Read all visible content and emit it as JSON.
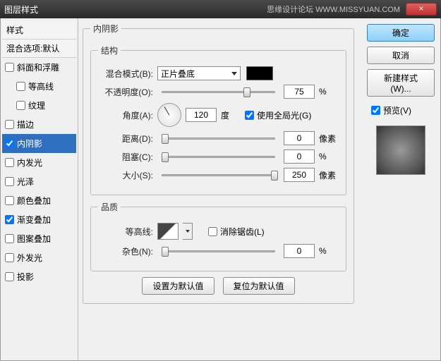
{
  "titlebar": {
    "title": "图层样式",
    "watermark": "思缘设计论坛 WWW.MISSYUAN.COM",
    "close": "×"
  },
  "sidebar": {
    "header": "样式",
    "blend": "混合选项:默认",
    "items": [
      {
        "label": "斜面和浮雕",
        "checked": false
      },
      {
        "label": "等高线",
        "checked": false,
        "sub": true
      },
      {
        "label": "纹理",
        "checked": false,
        "sub": true
      },
      {
        "label": "描边",
        "checked": false
      },
      {
        "label": "内阴影",
        "checked": true,
        "selected": true
      },
      {
        "label": "内发光",
        "checked": false
      },
      {
        "label": "光泽",
        "checked": false
      },
      {
        "label": "颜色叠加",
        "checked": false
      },
      {
        "label": "渐变叠加",
        "checked": true
      },
      {
        "label": "图案叠加",
        "checked": false
      },
      {
        "label": "外发光",
        "checked": false
      },
      {
        "label": "投影",
        "checked": false
      }
    ]
  },
  "panel": {
    "title": "内阴影",
    "structure": {
      "legend": "结构",
      "blendmode": {
        "label": "混合模式(B):",
        "value": "正片叠底"
      },
      "opacity": {
        "label": "不透明度(O):",
        "value": "75",
        "unit": "%",
        "pos": 72
      },
      "angle": {
        "label": "角度(A):",
        "value": "120",
        "unit": "度",
        "global": "使用全局光(G)",
        "globalChecked": true
      },
      "distance": {
        "label": "距离(D):",
        "value": "0",
        "unit": "像素",
        "pos": 0
      },
      "choke": {
        "label": "阻塞(C):",
        "value": "0",
        "unit": "%",
        "pos": 0
      },
      "size": {
        "label": "大小(S):",
        "value": "250",
        "unit": "像素",
        "pos": 96
      }
    },
    "quality": {
      "legend": "品质",
      "contour": {
        "label": "等高线:",
        "antialias": "消除锯齿(L)",
        "aaChecked": false
      },
      "noise": {
        "label": "杂色(N):",
        "value": "0",
        "unit": "%",
        "pos": 0
      }
    },
    "buttons": {
      "default": "设置为默认值",
      "reset": "复位为默认值"
    }
  },
  "right": {
    "ok": "确定",
    "cancel": "取消",
    "newstyle": "新建样式(W)...",
    "preview": {
      "label": "预览(V)",
      "checked": true
    }
  }
}
